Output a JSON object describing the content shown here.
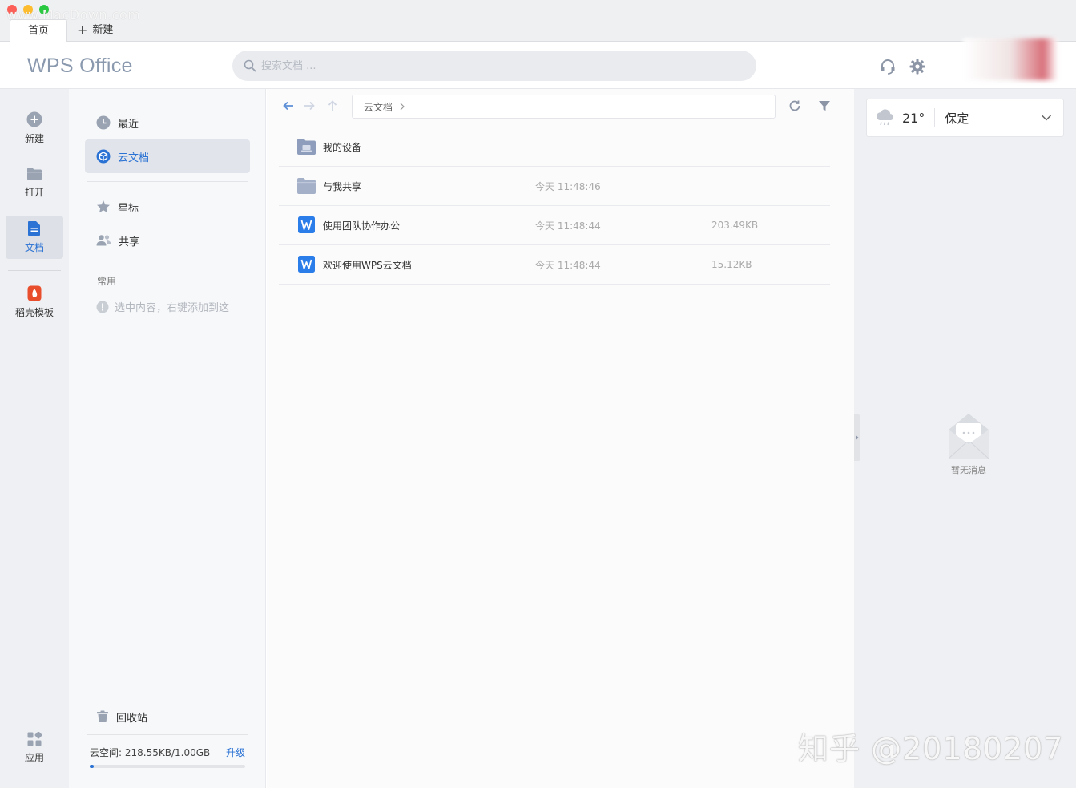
{
  "window": {
    "watermark": "www.MacDown.com"
  },
  "tabs": {
    "home": "首页",
    "new": "新建"
  },
  "header": {
    "logo": "WPS Office",
    "search_placeholder": "搜索文档 ..."
  },
  "rail": {
    "items": [
      {
        "label": "新建",
        "icon": "plus-circle-icon"
      },
      {
        "label": "打开",
        "icon": "folder-icon"
      },
      {
        "label": "文档",
        "icon": "document-icon"
      },
      {
        "label": "稻壳模板",
        "icon": "template-icon"
      }
    ],
    "apps": "应用"
  },
  "nav": {
    "recent": "最近",
    "cloud_docs": "云文档",
    "starred": "星标",
    "shared": "共享",
    "section_common": "常用",
    "common_hint": "选中内容，右键添加到这",
    "recycle": "回收站",
    "storage_label": "云空间: 218.55KB/1.00GB",
    "upgrade": "升级",
    "storage_used_fraction": 0.0002
  },
  "main": {
    "breadcrumb": "云文档",
    "files": [
      {
        "name": "我的设备",
        "time": "",
        "size": "",
        "kind": "device-folder"
      },
      {
        "name": "与我共享",
        "time": "今天 11:48:46",
        "size": "",
        "kind": "folder"
      },
      {
        "name": "使用团队协作办公",
        "time": "今天 11:48:44",
        "size": "203.49KB",
        "kind": "wps-doc"
      },
      {
        "name": "欢迎使用WPS云文档",
        "time": "今天 11:48:44",
        "size": "15.12KB",
        "kind": "wps-doc"
      }
    ]
  },
  "right": {
    "temperature": "21°",
    "city": "保定",
    "empty_message": "暂无消息"
  },
  "footer": {
    "watermark": "知乎 @20180207"
  },
  "colors": {
    "accent": "#2a72d4",
    "rail_bg": "#eff0f3",
    "nav_bg": "#f7f8fa"
  }
}
